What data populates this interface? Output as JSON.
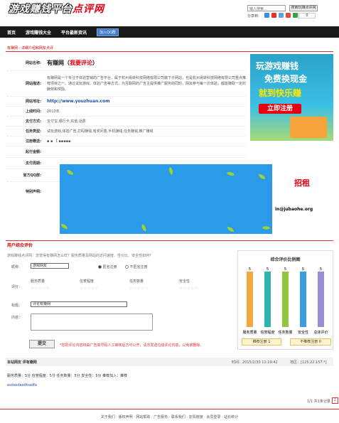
{
  "header": {
    "logo": "游戏赚钱平台",
    "logo_red": "点评网",
    "search_placeholder": "输入搜索...",
    "search_btn": "搜索玩赚点评网",
    "share_label": "分享到:",
    "share_count": "0"
  },
  "nav": {
    "items": [
      "首页",
      "游戏赚钱大全",
      "平台最新资讯"
    ],
    "qq_label": "加入QQ群"
  },
  "breadcrumb": "有赚网 - 详细介绍和网友点评",
  "site_info": {
    "rows": [
      {
        "label": "网站名称:",
        "value": "有赚网（",
        "value_em": "我要评论",
        "value_end": "）"
      },
      {
        "label": "网站描述:",
        "value": "有赚网是一个专注于体验营销的广告平台，属于杭州易转科技网络有限公司旗下子网站，也是杭州易转科技网络有限公司重点推荐项目之一。通过试玩游戏、体验广告等方式，为互联网的广告主提供推广服务的同时，网友参与每一次体验，都能赚取一定的酬劳和奖励。"
      },
      {
        "label": "网站地址:",
        "value": "http://www.youzhuan.com"
      },
      {
        "label": "上线时间:",
        "value": "2013年"
      },
      {
        "label": "支付方式:",
        "value": "支付宝,银行卡,充值,话费"
      },
      {
        "label": "任务类型:",
        "value": "试玩游戏,体验广告,打码赚钱,有奖问答,手机赚钱,任务赚钱,推广赚钱"
      },
      {
        "label": "注册赠送:",
        "value": "▪ ▪ 【 ▪▪▪▪▪"
      },
      {
        "label": "起付金额:",
        "value": ""
      },
      {
        "label": "支付周期:",
        "value": ""
      },
      {
        "label": "官方QQ群:",
        "value": ""
      },
      {
        "label": "特别声明:",
        "value": ""
      }
    ]
  },
  "side_ad": {
    "line1": "玩游戏赚钱",
    "line2": "免费换现金",
    "line3": "就到快乐赚",
    "cta": "立即注册"
  },
  "popup_ad": {
    "text_red": "招租",
    "email": "in@jubaohe.org"
  },
  "review_section": {
    "title": "用户综合评价",
    "hint": "游戏赚钱点评网：您觉得有赚网怎么样？服务质量及网站的访问速度、性价比、安全性如何？",
    "nickname_label": "昵称：",
    "nickname_value": "游戏网友",
    "anon_label": "匿名注册",
    "noanon_label": "不匿名注册",
    "score_label": "评分：",
    "score_items": [
      "服务质量",
      "信誉程度",
      "任务数量",
      "安全性"
    ],
    "title_label": "标题：",
    "title_value": "评论有赚网",
    "content_label": "内容：",
    "submit": "提交",
    "warning": "*您的评论内容将由广告商号码人工审核后方可公开，请勿发送垃圾评论内容，以免被删除。"
  },
  "chart_data": {
    "type": "bar",
    "title": "综合评价比例图",
    "categories": [
      "服务质量",
      "信誉程度",
      "任务数量",
      "安全性",
      "总体评价"
    ],
    "values": [
      5,
      5,
      5,
      5,
      5
    ],
    "ylim": [
      0,
      5
    ],
    "colors": [
      "#f2a93b",
      "#2fb6a8",
      "#8fc63f",
      "#3a9fe0",
      "#9b8fd4"
    ],
    "buttons": [
      "推荐注册 1",
      "不推荐注册 0"
    ]
  },
  "review_list": {
    "header_name": "本站网友 评有赚网",
    "time_label": "时间：",
    "time_value": "2015/2/30 11:19:42",
    "ip_label": "地区：",
    "ip_value": "[125.22.157.*]",
    "row": "服务质量：5分    信誉程度：5分    任务数量：5分    安全性：5分    推荐加入：推荐",
    "comment": "asdasdasdfsadfa"
  },
  "pager": {
    "text": "1/1 共1条记录",
    "page": "1"
  },
  "footer": "关于我们 · 版权声明 · 网站帮助 · 广告服务 · 联系我们 · 友情链接 · 会员登录 · 站长统计"
}
